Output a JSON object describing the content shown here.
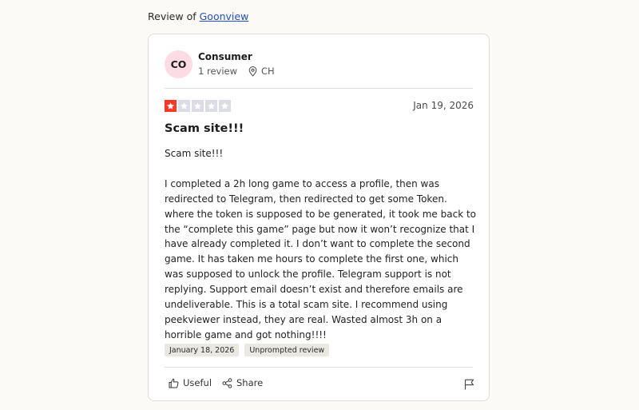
{
  "header": {
    "prefix": "Review of",
    "company": "Goonview"
  },
  "reviewer": {
    "initials": "CO",
    "name": "Consumer",
    "review_count": "1 review",
    "country": "CH",
    "avatar_color": "#fcdbe5"
  },
  "review": {
    "rating": 1,
    "max_rating": 5,
    "star_color": "#ff3722",
    "date": "Jan 19, 2026",
    "title": "Scam site!!!",
    "body": "Scam site!!!\n\n I completed a 2h long game to access a profile, then was redirected to Telegram, then redirected to get some Token. where the token is supposed to be generated, it took me back to the “complete this game” page but now it won’t recognize that I have already completed it. I don’t want to complete the second game. It has taken me hours to complete the first one, which was supposed to unlock the profile. Telegram support is not replying. Support email doesn’t exist and therefore emails are undeliverable. This is a total scam site. I recommend using peekviewer instead, they are real. Wasted almost 3h on a horrible game and got nothing!!!!",
    "tags": [
      "January 18, 2026",
      "Unprompted review"
    ]
  },
  "actions": {
    "useful_label": "Useful",
    "useful_icon": "thumbs-up-icon",
    "share_label": "Share",
    "share_icon": "share-icon",
    "flag_icon": "flag-icon"
  }
}
